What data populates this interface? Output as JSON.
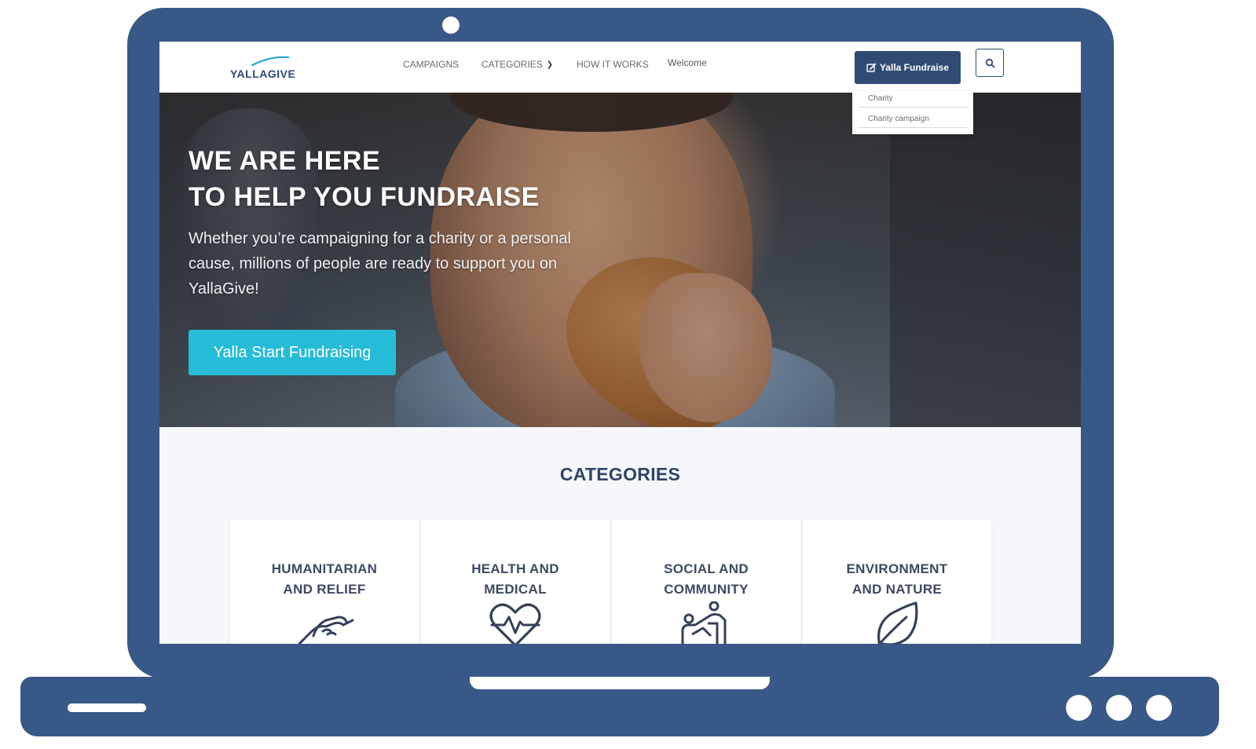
{
  "nav": {
    "logo_text": "YALLAGIVE",
    "links": {
      "campaigns": "CAMPAIGNS",
      "categories": "CATEGORIES",
      "how_it_works": "HOW IT WORKS",
      "welcome": "Welcome"
    },
    "fundraise_button": "Yalla Fundraise",
    "dropdown": [
      "Charity",
      "Charity campaign"
    ]
  },
  "hero": {
    "title_line1": "WE ARE HERE",
    "title_line2": "TO HELP YOU FUNDRAISE",
    "subtitle": "Whether you’re campaigning for a charity or a personal cause, millions of people are ready to support you on YallaGive!",
    "cta": "Yalla Start Fundraising"
  },
  "categories": {
    "heading": "CATEGORIES",
    "cards": [
      {
        "line1": "HUMANITARIAN",
        "line2": "AND RELIEF",
        "icon": "handshake-icon"
      },
      {
        "line1": "HEALTH AND",
        "line2": "MEDICAL",
        "icon": "heartbeat-icon"
      },
      {
        "line1": "SOCIAL AND",
        "line2": "COMMUNITY",
        "icon": "community-icon"
      },
      {
        "line1": "ENVIRONMENT",
        "line2": "AND NATURE",
        "icon": "leaf-icon"
      }
    ]
  },
  "colors": {
    "frame": "#385887",
    "primary": "#2f4b75",
    "accent": "#26bcd8",
    "heading": "#2f4466"
  }
}
